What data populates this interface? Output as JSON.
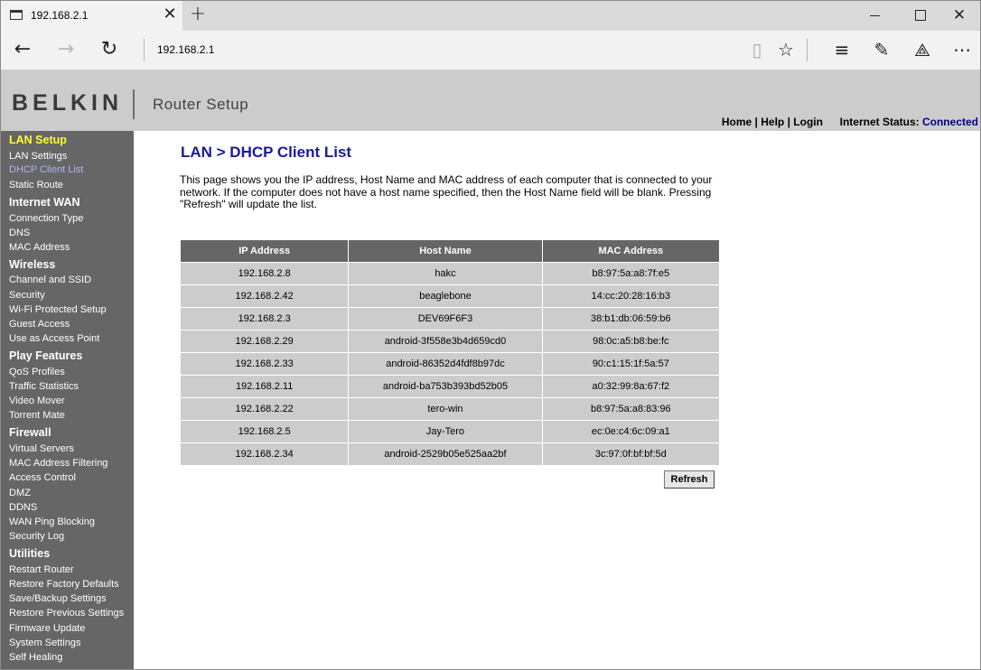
{
  "browser": {
    "tab_title": "192.168.2.1",
    "address": "192.168.2.1",
    "close_glyph": "✕",
    "new_tab_glyph": "+"
  },
  "header": {
    "brand": "BELKIN",
    "product": "Router Setup",
    "links": {
      "home": "Home",
      "help": "Help",
      "login": "Login"
    },
    "status_label": "Internet Status:",
    "status_value": "Connected",
    "status_color": "#00008b"
  },
  "sidebar": {
    "lan_setup": "LAN Setup",
    "lan_settings": "LAN Settings",
    "dhcp_client_list": "DHCP Client List",
    "static_route": "Static Route",
    "internet_wan": "Internet WAN",
    "connection_type": "Connection Type",
    "dns": "DNS",
    "mac_address": "MAC Address",
    "wireless": "Wireless",
    "channel_ssid": "Channel and SSID",
    "security": "Security",
    "wps": "Wi-Fi Protected Setup",
    "guest_access": "Guest Access",
    "access_point": "Use as Access Point",
    "play_features": "Play Features",
    "qos": "QoS Profiles",
    "traffic": "Traffic Statistics",
    "video_mover": "Video Mover",
    "torrent_mate": "Torrent Mate",
    "firewall": "Firewall",
    "virtual_servers": "Virtual Servers",
    "mac_filtering": "MAC Address Filtering",
    "access_control": "Access Control",
    "dmz": "DMZ",
    "ddns": "DDNS",
    "wan_ping": "WAN Ping Blocking",
    "security_log": "Security Log",
    "utilities": "Utilities",
    "restart": "Restart Router",
    "restore_defaults": "Restore Factory Defaults",
    "save_backup": "Save/Backup Settings",
    "restore_previous": "Restore Previous Settings",
    "firmware": "Firmware Update",
    "system_settings": "System Settings",
    "self_healing": "Self Healing"
  },
  "main": {
    "title": "LAN > DHCP Client List",
    "description": "This page shows you the IP address, Host Name and MAC address of each computer that is connected to your network. If the computer does not have a host name specified, then the Host Name field will be blank. Pressing \"Refresh\" will update the list.",
    "columns": [
      "IP Address",
      "Host Name",
      "MAC Address"
    ],
    "rows": [
      [
        "192.168.2.8",
        "hakc",
        "b8:97:5a:a8:7f:e5"
      ],
      [
        "192.168.2.42",
        "beaglebone",
        "14:cc:20:28:16:b3"
      ],
      [
        "192.168.2.3",
        "DEV69F6F3",
        "38:b1:db:06:59:b6"
      ],
      [
        "192.168.2.29",
        "android-3f558e3b4d659cd0",
        "98:0c:a5:b8:be:fc"
      ],
      [
        "192.168.2.33",
        "android-86352d4fdf8b97dc",
        "90:c1:15:1f:5a:57"
      ],
      [
        "192.168.2.11",
        "android-ba753b393bd52b05",
        "a0:32:99:8a:67:f2"
      ],
      [
        "192.168.2.22",
        "tero-win",
        "b8:97:5a:a8:83:96"
      ],
      [
        "192.168.2.5",
        "Jay-Tero",
        "ec:0e:c4:6c:09:a1"
      ],
      [
        "192.168.2.34",
        "android-2529b05e525aa2bf",
        "3c:97:0f:bf:bf:5d"
      ]
    ],
    "refresh_label": "Refresh"
  }
}
